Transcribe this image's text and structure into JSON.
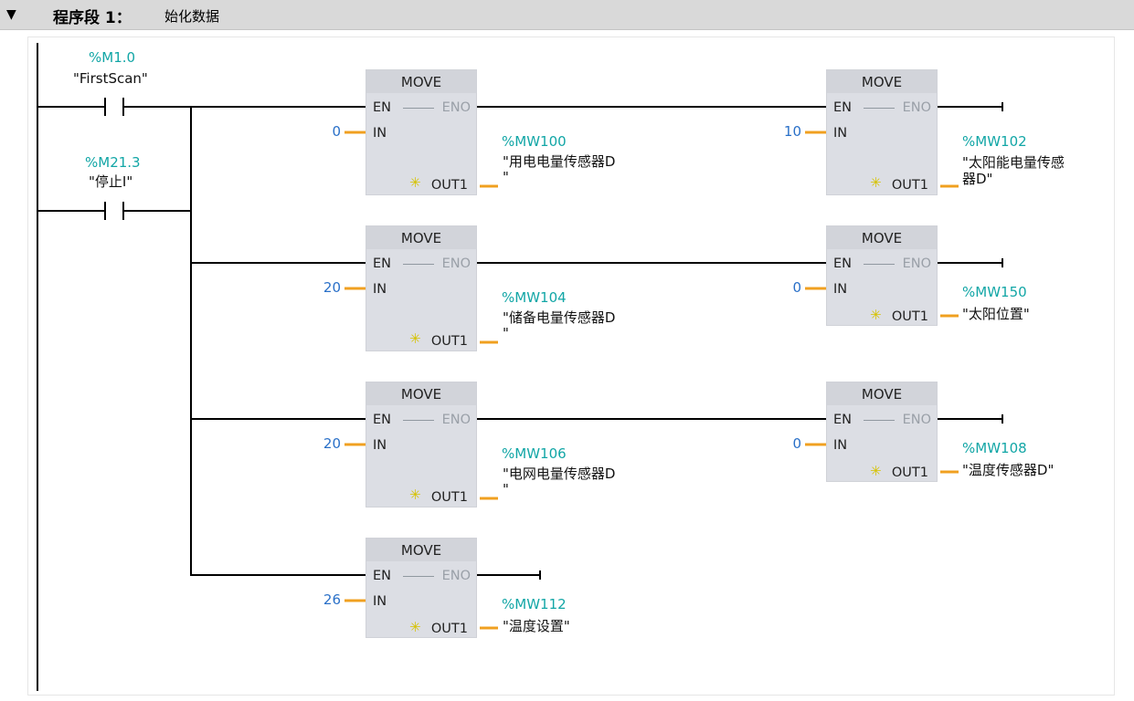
{
  "network": {
    "toggle_icon": "triangle-down-icon",
    "title": "程序段 1：",
    "comment": "始化数据"
  },
  "contacts": [
    {
      "address": "%M1.0",
      "symbol": "\"FirstScan\""
    },
    {
      "address": "%M21.3",
      "symbol": "\"停止I\""
    }
  ],
  "blocks": [
    {
      "name": "MOVE",
      "en": "EN",
      "eno": "ENO",
      "in_pin": "IN",
      "out_pin": "OUT1",
      "in_value": "0",
      "out_address": "%MW100",
      "out_symbol": "\"用电电量传感器D\n\""
    },
    {
      "name": "MOVE",
      "en": "EN",
      "eno": "ENO",
      "in_pin": "IN",
      "out_pin": "OUT1",
      "in_value": "10",
      "out_address": "%MW102",
      "out_symbol": "\"太阳能电量传感\n器D\""
    },
    {
      "name": "MOVE",
      "en": "EN",
      "eno": "ENO",
      "in_pin": "IN",
      "out_pin": "OUT1",
      "in_value": "20",
      "out_address": "%MW104",
      "out_symbol": "\"储备电量传感器D\n\""
    },
    {
      "name": "MOVE",
      "en": "EN",
      "eno": "ENO",
      "in_pin": "IN",
      "out_pin": "OUT1",
      "in_value": "0",
      "out_address": "%MW150",
      "out_symbol": "\"太阳位置\""
    },
    {
      "name": "MOVE",
      "en": "EN",
      "eno": "ENO",
      "in_pin": "IN",
      "out_pin": "OUT1",
      "in_value": "20",
      "out_address": "%MW106",
      "out_symbol": "\"电网电量传感器D\n\""
    },
    {
      "name": "MOVE",
      "en": "EN",
      "eno": "ENO",
      "in_pin": "IN",
      "out_pin": "OUT1",
      "in_value": "0",
      "out_address": "%MW108",
      "out_symbol": "\"温度传感器D\""
    },
    {
      "name": "MOVE",
      "en": "EN",
      "eno": "ENO",
      "in_pin": "IN",
      "out_pin": "OUT1",
      "in_value": "26",
      "out_address": "%MW112",
      "out_symbol": "\"温度设置\""
    }
  ],
  "colors": {
    "address": "#12a6a6",
    "constant": "#2a70c8",
    "wire": "#000000",
    "out_wire": "#f0a020",
    "block_fill": "#dcdee4"
  }
}
